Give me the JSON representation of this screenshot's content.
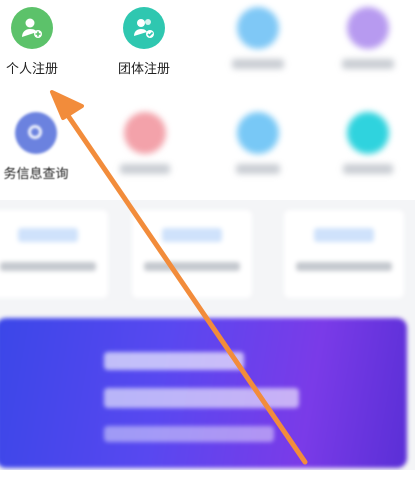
{
  "apps_row1": [
    {
      "label": "个人注册",
      "color": "#5cc26a",
      "icon": "person-add-icon"
    },
    {
      "label": "团体注册",
      "color": "#2fc7b0",
      "icon": "group-add-icon"
    },
    {
      "label": "",
      "color": "#7fc8f6",
      "icon": "blurred-icon"
    },
    {
      "label": "",
      "color": "#b79af0",
      "icon": "blurred-icon"
    }
  ],
  "apps_row2": [
    {
      "label": "务信息查询",
      "color": "#6b82df",
      "icon": "search-icon"
    },
    {
      "label": "",
      "color": "#f3a2aa",
      "icon": "blurred-icon"
    },
    {
      "label": "",
      "color": "#78c8f6",
      "icon": "blurred-icon"
    },
    {
      "label": "",
      "color": "#2fd3de",
      "icon": "blurred-icon"
    }
  ],
  "colors": {
    "arrow": "#f28c3b",
    "banner_start": "#3b47e8",
    "banner_end": "#7a3be8"
  }
}
